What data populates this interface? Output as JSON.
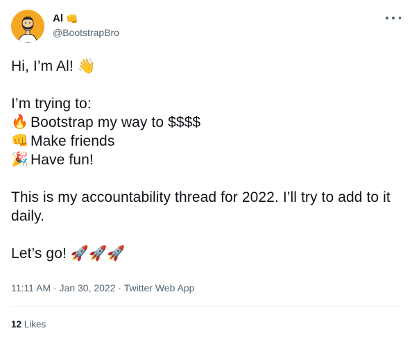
{
  "author": {
    "display_name": "Al",
    "display_emoji": "👊",
    "handle": "@BootstrapBro"
  },
  "icons": {
    "more": "more-dots-icon",
    "avatar": "avatar-illustration",
    "verified_emoji": "fist-bump-emoji"
  },
  "tweet": {
    "greeting": "Hi, I’m Al! 👋",
    "intro": "I’m trying to:",
    "goals": [
      {
        "emoji": "🔥",
        "text": "Bootstrap my way to $$$$"
      },
      {
        "emoji": "👊",
        "text": "Make friends"
      },
      {
        "emoji": "🎉",
        "text": "Have fun!"
      }
    ],
    "accountability": "This is my accountability thread for 2022. I’ll try to add to it daily.",
    "closing": "Let’s go! 🚀🚀🚀"
  },
  "meta": {
    "time": "11:11 AM",
    "separator": "·",
    "date": "Jan 30, 2022",
    "source": "Twitter Web App"
  },
  "stats": {
    "likes_count": "12",
    "likes_label": "Likes"
  },
  "colors": {
    "text": "#0f1419",
    "secondary": "#536471",
    "divider": "#eff3f4",
    "avatar_bg": "#f5a623"
  }
}
